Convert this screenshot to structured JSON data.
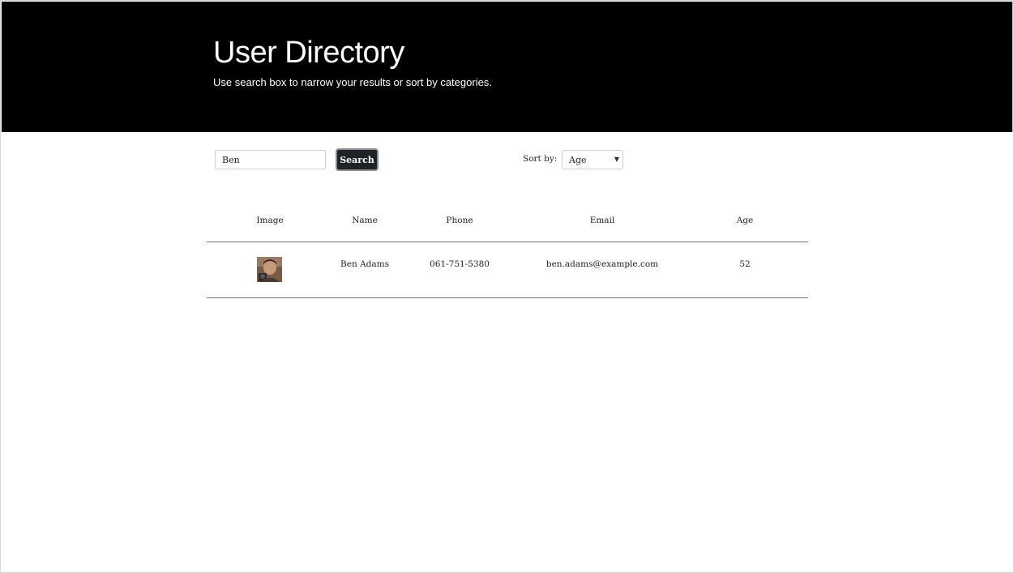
{
  "header": {
    "title": "User Directory",
    "subtitle": "Use search box to narrow your results or sort by categories."
  },
  "search": {
    "value": "Ben",
    "button_label": "Search"
  },
  "sort": {
    "label": "Sort by:",
    "selected": "Age"
  },
  "table": {
    "columns": [
      "Image",
      "Name",
      "Phone",
      "Email",
      "Age"
    ],
    "rows": [
      {
        "image": "avatar",
        "name": "Ben Adams",
        "phone": "061-751-5380",
        "email": "ben.adams@example.com",
        "age": "52"
      }
    ]
  }
}
